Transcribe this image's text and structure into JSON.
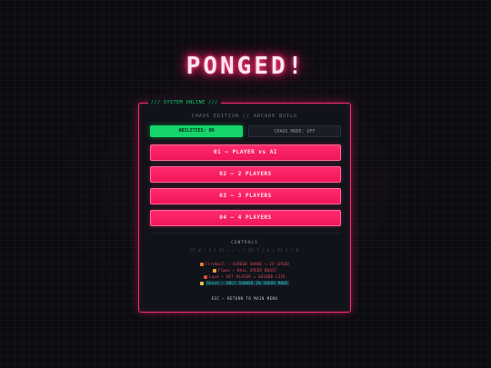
{
  "title": "PONGED!",
  "panel": {
    "tag": "/// SYSTEM ONLINE ///",
    "subtitle": "CHAOS EDITION // ARCADE BUILD"
  },
  "toggles": {
    "abilities": "ABILITIES: ON",
    "chaos": "CHAOS MODE: OFF"
  },
  "modes": [
    {
      "label": "01 — PLAYER vs AI"
    },
    {
      "label": "02 — 2 PLAYERS"
    },
    {
      "label": "03 — 3 PLAYERS"
    },
    {
      "label": "04 — 4 PLAYERS"
    }
  ],
  "controls": {
    "heading": "CONTROLS",
    "keys": "P1 W / S  |  P2 ↑ / ↓  |  P3 T / G  |  P4 I / K"
  },
  "powerups": [
    {
      "text": "Fireball — SCREEN SHAKE + 2X SPEED",
      "color": "#e94b5b",
      "icon": "fireball-icon"
    },
    {
      "text": "Flame — BALL SPEED BOOST",
      "color": "#e94b5b",
      "icon": "flame-icon"
    },
    {
      "text": "Lava — HIT PLAYER = SECOND LIFE",
      "color": "#e94b5b",
      "icon": "lava-icon"
    },
    {
      "text": "Ghost — ONLY SHOWED IN CHAOS MODE",
      "color": "#27c8d8",
      "icon": "ghost-icon"
    }
  ],
  "esc": "ESC — RETURN TO MAIN MENU",
  "colors": {
    "accent": "#ff2a6d",
    "on": "#14d46a",
    "cyan": "#27c8d8"
  }
}
